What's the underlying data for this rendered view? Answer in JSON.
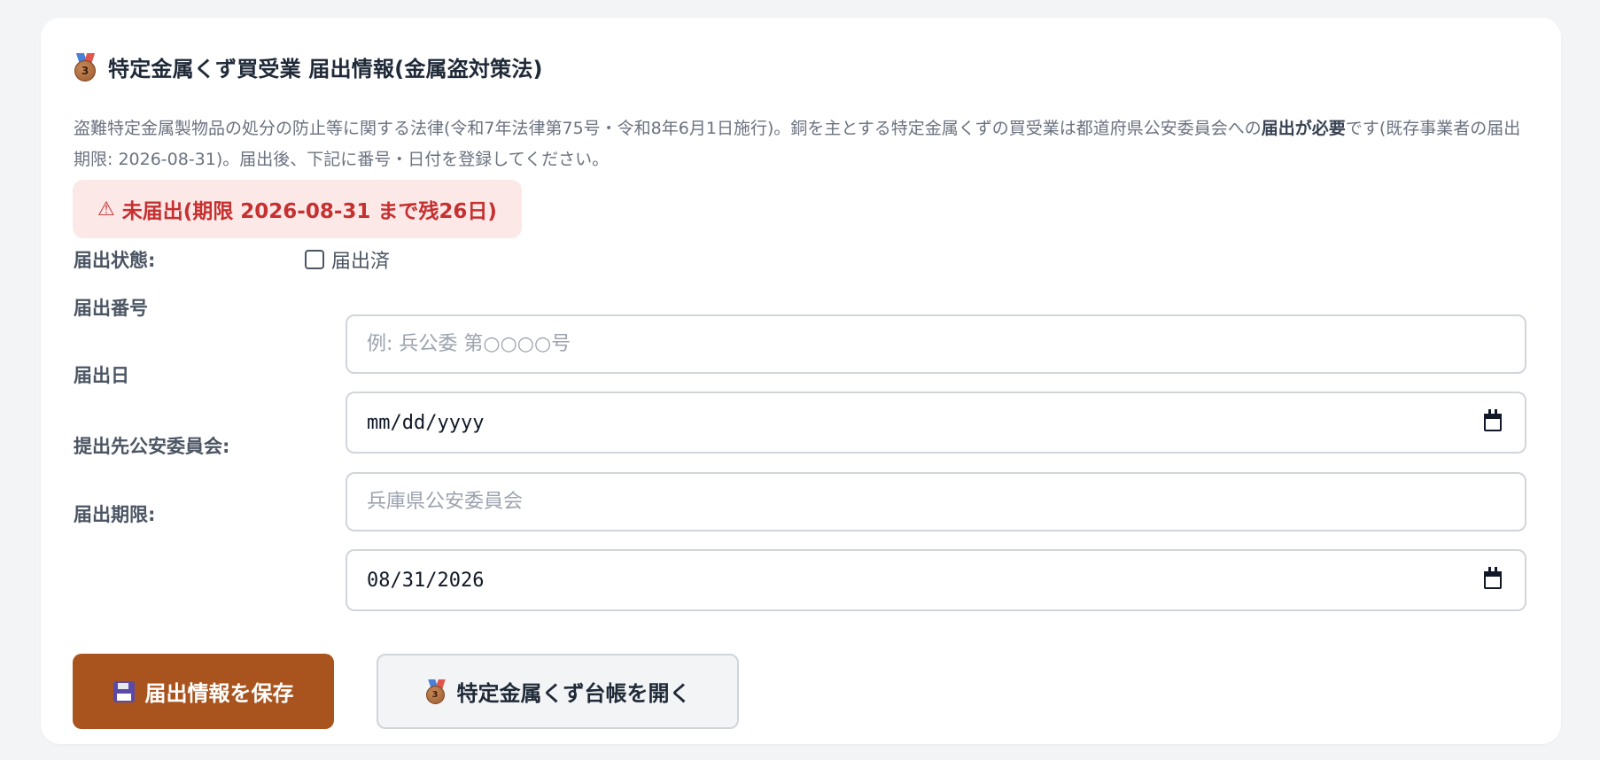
{
  "header": {
    "icon": "bronze-medal-icon",
    "title": "特定金属くず買受業 届出情報(金属盗対策法)"
  },
  "description": {
    "part1": "盗難特定金属製物品の処分の防止等に関する法律(令和7年法律第75号・令和8年6月1日施行)。銅を主とする特定金属くずの買受業は都道府県公安委員会への",
    "bold": "届出が必要",
    "part2": "です(既存事業者の届出期限: 2026-08-31)。届出後、下記に番号・日付を登録してください。"
  },
  "alert": {
    "icon": "⚠",
    "text": "未届出(期限 2026-08-31 まで残26日)",
    "color": "#c53030",
    "background": "#fde8e8"
  },
  "form": {
    "status_label": "届出状態:",
    "status_checkbox_label": "届出済",
    "status_checked": false,
    "number_label": "届出番号",
    "number_placeholder": "例: 兵公委 第○○○○号",
    "number_value": "",
    "date_label": "届出日",
    "date_value": "mm/dd/yyyy",
    "committee_label": "提出先公安委員会:",
    "committee_placeholder": "兵庫県公安委員会",
    "committee_value": "",
    "deadline_label": "届出期限:",
    "deadline_value": "08/31/2026"
  },
  "buttons": {
    "save_label": "届出情報を保存",
    "save_icon": "floppy-disk-icon",
    "save_color": "#a9541e",
    "ledger_label": "特定金属くず台帳を開く",
    "ledger_icon": "bronze-medal-icon"
  }
}
